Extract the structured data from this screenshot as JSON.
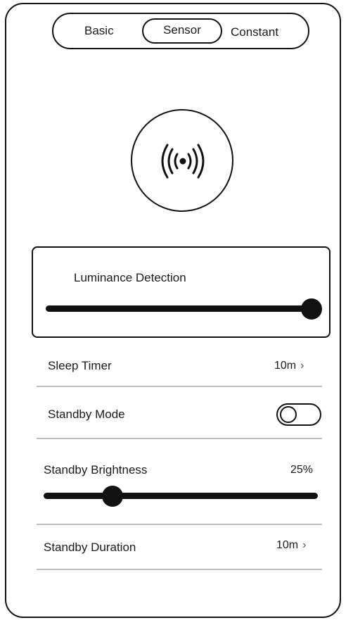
{
  "tabs": {
    "basic": "Basic",
    "sensor": "Sensor",
    "constant": "Constant",
    "selected": "Sensor"
  },
  "sensor_button": {
    "icon": "sensor-waves-icon"
  },
  "luminance": {
    "label": "Luminance Detection",
    "level": 1.0
  },
  "sleep_timer": {
    "label": "Sleep Timer",
    "value": "10m",
    "chevron": "›"
  },
  "standby_mode": {
    "label": "Standby Mode",
    "enabled": false
  },
  "standby_brightness": {
    "label": "Standby Brightness",
    "value": "25%",
    "level": 0.25
  },
  "standby_duration": {
    "label": "Standby Duration",
    "value": "10m",
    "chevron": "›"
  },
  "colors": {
    "stroke": "#111111",
    "divider": "#bdbdbd",
    "background": "#ffffff"
  }
}
